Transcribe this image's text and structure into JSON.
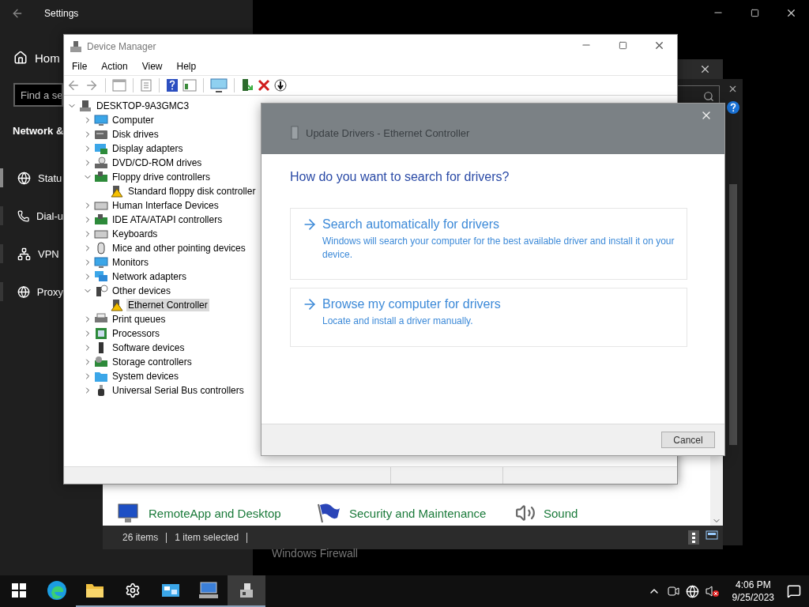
{
  "settings": {
    "title": "Settings",
    "home": "Hom",
    "search": {
      "placeholder": "Find a se"
    },
    "section_title": "Network &",
    "nav": [
      {
        "label": "Statu",
        "kind": "status",
        "selected": true
      },
      {
        "label": "Dial-u",
        "kind": "dialup",
        "selected": false
      },
      {
        "label": "VPN",
        "kind": "vpn",
        "selected": false
      },
      {
        "label": "Proxy",
        "kind": "proxy",
        "selected": false
      }
    ]
  },
  "control_panel": {
    "items": [
      {
        "label": "RemoteApp and Desktop",
        "kind": "remote"
      },
      {
        "label": "Security and Maintenance",
        "kind": "flag"
      },
      {
        "label": "Sound",
        "kind": "speaker"
      }
    ],
    "status_bar": [
      "26 items",
      "1 item selected"
    ]
  },
  "background_text": "Windows Firewall",
  "device_manager": {
    "title": "Device Manager",
    "menu": [
      "File",
      "Action",
      "View",
      "Help"
    ],
    "tree": {
      "label": "DESKTOP-9A3GMC3",
      "kind": "computer",
      "expanded": true,
      "selected": false,
      "children": [
        {
          "label": "Computer",
          "kind": "monitor",
          "expanded": false,
          "selected": false
        },
        {
          "label": "Disk drives",
          "kind": "disk",
          "expanded": false,
          "selected": false
        },
        {
          "label": "Display adapters",
          "kind": "display",
          "expanded": false,
          "selected": false
        },
        {
          "label": "DVD/CD-ROM drives",
          "kind": "dvd",
          "expanded": false,
          "selected": false
        },
        {
          "label": "Floppy drive controllers",
          "kind": "card",
          "expanded": true,
          "selected": false,
          "children": [
            {
              "label": "Standard floppy disk controller",
              "kind": "warning",
              "selected": false
            }
          ]
        },
        {
          "label": "Human Interface Devices",
          "kind": "keyboard",
          "expanded": false,
          "selected": false
        },
        {
          "label": "IDE ATA/ATAPI controllers",
          "kind": "card",
          "expanded": false,
          "selected": false
        },
        {
          "label": "Keyboards",
          "kind": "keyboard",
          "expanded": false,
          "selected": false
        },
        {
          "label": "Mice and other pointing devices",
          "kind": "mouse",
          "expanded": false,
          "selected": false
        },
        {
          "label": "Monitors",
          "kind": "monitor",
          "expanded": false,
          "selected": false
        },
        {
          "label": "Network adapters",
          "kind": "network",
          "expanded": false,
          "selected": false
        },
        {
          "label": "Other devices",
          "kind": "unknown",
          "expanded": true,
          "selected": false,
          "children": [
            {
              "label": "Ethernet Controller",
              "kind": "warning",
              "selected": true
            }
          ]
        },
        {
          "label": "Print queues",
          "kind": "printer",
          "expanded": false,
          "selected": false
        },
        {
          "label": "Processors",
          "kind": "chip",
          "expanded": false,
          "selected": false
        },
        {
          "label": "Software devices",
          "kind": "tower",
          "expanded": false,
          "selected": false
        },
        {
          "label": "Storage controllers",
          "kind": "storage",
          "expanded": false,
          "selected": false
        },
        {
          "label": "System devices",
          "kind": "folder",
          "expanded": false,
          "selected": false
        },
        {
          "label": "Universal Serial Bus controllers",
          "kind": "usb",
          "expanded": false,
          "selected": false
        }
      ]
    }
  },
  "dialog": {
    "title": "Update Drivers - Ethernet Controller",
    "heading": "How do you want to search for drivers?",
    "options": [
      {
        "title": "Search automatically for drivers",
        "description": "Windows will search your computer for the best available driver and install it on your device."
      },
      {
        "title": "Browse my computer for drivers",
        "description": "Locate and install a driver manually."
      }
    ],
    "cancel": "Cancel"
  },
  "taskbar": {
    "apps": [
      {
        "kind": "start",
        "running": false,
        "active": false
      },
      {
        "kind": "edge",
        "running": false,
        "active": false
      },
      {
        "kind": "folder",
        "running": true,
        "active": false
      },
      {
        "kind": "settings",
        "running": true,
        "active": false
      },
      {
        "kind": "control",
        "running": true,
        "active": false
      },
      {
        "kind": "network",
        "running": true,
        "active": false
      },
      {
        "kind": "device",
        "running": true,
        "active": true
      }
    ],
    "time": "4:06 PM",
    "date": "9/25/2023"
  }
}
